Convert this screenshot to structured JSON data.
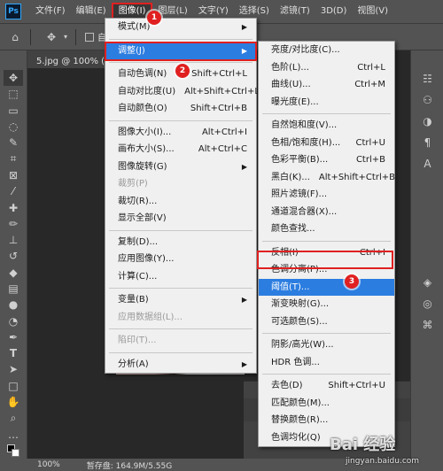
{
  "menubar": {
    "logo": "Ps",
    "items": [
      "文件(F)",
      "编辑(E)",
      "图像(I)",
      "图层(L)",
      "文字(Y)",
      "选择(S)",
      "滤镜(T)",
      "3D(D)",
      "视图(V)"
    ]
  },
  "optbar": {
    "auto_label": "自动"
  },
  "tab": {
    "title": "5.jpg @ 100% (图"
  },
  "image_menu": {
    "items": [
      {
        "label": "模式(M)",
        "shortcut": "",
        "arrow": true
      },
      {
        "sep": true
      },
      {
        "label": "调整(J)",
        "shortcut": "",
        "arrow": true,
        "highlight": true
      },
      {
        "sep": true
      },
      {
        "label": "自动色调(N)",
        "shortcut": "Shift+Ctrl+L"
      },
      {
        "label": "自动对比度(U)",
        "shortcut": "Alt+Shift+Ctrl+L"
      },
      {
        "label": "自动颜色(O)",
        "shortcut": "Shift+Ctrl+B"
      },
      {
        "sep": true
      },
      {
        "label": "图像大小(I)...",
        "shortcut": "Alt+Ctrl+I"
      },
      {
        "label": "画布大小(S)...",
        "shortcut": "Alt+Ctrl+C"
      },
      {
        "label": "图像旋转(G)",
        "shortcut": "",
        "arrow": true
      },
      {
        "label": "裁剪(P)",
        "shortcut": "",
        "disabled": true
      },
      {
        "label": "裁切(R)...",
        "shortcut": ""
      },
      {
        "label": "显示全部(V)",
        "shortcut": ""
      },
      {
        "sep": true
      },
      {
        "label": "复制(D)...",
        "shortcut": ""
      },
      {
        "label": "应用图像(Y)...",
        "shortcut": ""
      },
      {
        "label": "计算(C)...",
        "shortcut": ""
      },
      {
        "sep": true
      },
      {
        "label": "变量(B)",
        "shortcut": "",
        "arrow": true
      },
      {
        "label": "应用数据组(L)...",
        "shortcut": "",
        "disabled": true
      },
      {
        "sep": true
      },
      {
        "label": "陷印(T)...",
        "shortcut": "",
        "disabled": true
      },
      {
        "sep": true
      },
      {
        "label": "分析(A)",
        "shortcut": "",
        "arrow": true
      }
    ]
  },
  "adjust_menu": {
    "items": [
      {
        "label": "亮度/对比度(C)...",
        "shortcut": ""
      },
      {
        "label": "色阶(L)...",
        "shortcut": "Ctrl+L"
      },
      {
        "label": "曲线(U)...",
        "shortcut": "Ctrl+M"
      },
      {
        "label": "曝光度(E)...",
        "shortcut": ""
      },
      {
        "sep": true
      },
      {
        "label": "自然饱和度(V)...",
        "shortcut": ""
      },
      {
        "label": "色相/饱和度(H)...",
        "shortcut": "Ctrl+U"
      },
      {
        "label": "色彩平衡(B)...",
        "shortcut": "Ctrl+B"
      },
      {
        "label": "黑白(K)...",
        "shortcut": "Alt+Shift+Ctrl+B"
      },
      {
        "label": "照片滤镜(F)...",
        "shortcut": ""
      },
      {
        "label": "通道混合器(X)...",
        "shortcut": ""
      },
      {
        "label": "颜色查找...",
        "shortcut": ""
      },
      {
        "sep": true
      },
      {
        "label": "反相(I)",
        "shortcut": "Ctrl+I"
      },
      {
        "label": "色调分离(P)...",
        "shortcut": ""
      },
      {
        "label": "阈值(T)...",
        "shortcut": "",
        "highlight": true
      },
      {
        "label": "渐变映射(G)...",
        "shortcut": ""
      },
      {
        "label": "可选颜色(S)...",
        "shortcut": ""
      },
      {
        "sep": true
      },
      {
        "label": "阴影/高光(W)...",
        "shortcut": ""
      },
      {
        "label": "HDR 色调...",
        "shortcut": ""
      },
      {
        "sep": true
      },
      {
        "label": "去色(D)",
        "shortcut": "Shift+Ctrl+U"
      },
      {
        "label": "匹配颜色(M)...",
        "shortcut": ""
      },
      {
        "label": "替换颜色(R)...",
        "shortcut": ""
      },
      {
        "label": "色调均化(Q)",
        "shortcut": ""
      }
    ]
  },
  "badges": [
    "1",
    "2",
    "3"
  ],
  "status": {
    "zoom": "100%",
    "scratch": "暂存盘: 164.9M/5.55G"
  },
  "watermark": {
    "brand": "Bai 经验",
    "url": "jingyan.baidu.com"
  },
  "colors": {
    "highlight": "#2c7de0",
    "annotation": "#e02020"
  }
}
